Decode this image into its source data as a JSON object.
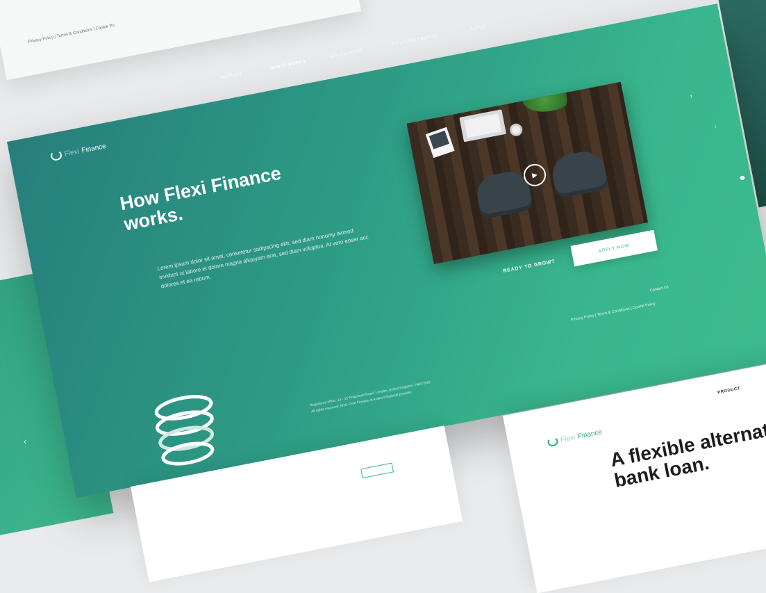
{
  "top_strip": {
    "links": "Privacy Policy  |  Terms & Conditions  |  Cookie Po"
  },
  "hero": {
    "nav": {
      "product": "PRODUCT",
      "how_it_works": "HOW IT WORKS",
      "calculator": "CALCULATOR",
      "why": "WHY FLEXI FINANCE",
      "about": "ABOUT"
    },
    "logo": {
      "flexi": "Flexi",
      "finance": "Finance"
    },
    "title": "How Flexi Finance works.",
    "body": "Lorem ipsum dolor sit amet, consetetur sadipscing elitr, sed diam nonumy eirmod invidunt ut labore et dolore magna aliquyam erat, sed diam voluptua. At vero eoser acc dolores et ea rebum.",
    "ready": "READY TO GROW?",
    "apply": "APPLY NOW",
    "contact": "Contact Us",
    "legal": "Privacy Policy  |  Terms & Conditions  |  Cookie Policy",
    "registered_1": "Registered office: 13 - 15 Rosemont Road, London, United Kingdom, NW3 6NG",
    "registered_2": "All rights reserved 2018. Flexi Finance is a direct financial provider.",
    "next_arrow": "›",
    "prev_arrow": "‹",
    "play_icon": "▶",
    "social": {
      "facebook": "f",
      "twitter": "t",
      "instagram": "◎"
    }
  },
  "left_page": {
    "arrow": "‹"
  },
  "right_page": {
    "product": "PRODUCT",
    "logo": {
      "flexi": "Flexi",
      "finance": "Finance"
    },
    "headline": "A flexible alternative to a bank loan."
  }
}
